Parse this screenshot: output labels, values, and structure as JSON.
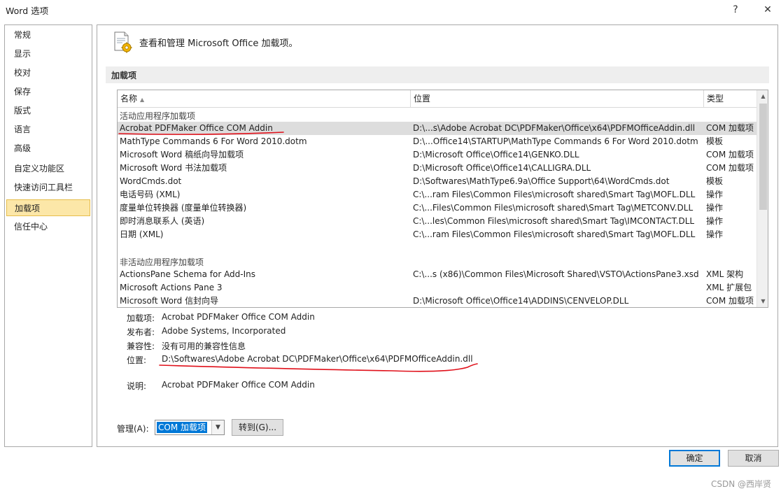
{
  "window": {
    "title": "Word 选项",
    "help_label": "?",
    "close_label": "✕"
  },
  "sidebar": {
    "items": [
      {
        "label": "常规"
      },
      {
        "label": "显示"
      },
      {
        "label": "校对"
      },
      {
        "label": "保存"
      },
      {
        "label": "版式"
      },
      {
        "label": "语言"
      },
      {
        "label": "高级"
      },
      {
        "label": "自定义功能区"
      },
      {
        "label": "快速访问工具栏"
      },
      {
        "label": "加载项",
        "active": true
      },
      {
        "label": "信任中心"
      }
    ]
  },
  "main": {
    "header_text": "查看和管理 Microsoft Office 加载项。",
    "section_title": "加载项",
    "columns": {
      "name": "名称",
      "location": "位置",
      "type": "类型"
    },
    "active_group_label": "活动应用程序加载项",
    "active_rows": [
      {
        "name": "Acrobat PDFMaker Office COM Addin",
        "location": "D:\\...s\\Adobe Acrobat DC\\PDFMaker\\Office\\x64\\PDFMOfficeAddin.dll",
        "type": "COM 加载项",
        "selected": true
      },
      {
        "name": "MathType Commands 6 For Word 2010.dotm",
        "location": "D:\\...Office14\\STARTUP\\MathType Commands 6 For Word 2010.dotm",
        "type": "模板"
      },
      {
        "name": "Microsoft Word 稿纸向导加载项",
        "location": "D:\\Microsoft Office\\Office14\\GENKO.DLL",
        "type": "COM 加载项"
      },
      {
        "name": "Microsoft Word 书法加载项",
        "location": "D:\\Microsoft Office\\Office14\\CALLIGRA.DLL",
        "type": "COM 加载项"
      },
      {
        "name": "WordCmds.dot",
        "location": "D:\\Softwares\\MathType6.9a\\Office Support\\64\\WordCmds.dot",
        "type": "模板"
      },
      {
        "name": "电话号码 (XML)",
        "location": "C:\\...ram Files\\Common Files\\microsoft shared\\Smart Tag\\MOFL.DLL",
        "type": "操作"
      },
      {
        "name": "度量单位转换器 (度量单位转换器)",
        "location": "C:\\...Files\\Common Files\\microsoft shared\\Smart Tag\\METCONV.DLL",
        "type": "操作"
      },
      {
        "name": "即时消息联系人 (英语)",
        "location": "C:\\...les\\Common Files\\microsoft shared\\Smart Tag\\IMCONTACT.DLL",
        "type": "操作"
      },
      {
        "name": "日期 (XML)",
        "location": "C:\\...ram Files\\Common Files\\microsoft shared\\Smart Tag\\MOFL.DLL",
        "type": "操作"
      }
    ],
    "inactive_group_label": "非活动应用程序加载项",
    "inactive_rows": [
      {
        "name": "ActionsPane Schema for Add-Ins",
        "location": "C:\\...s (x86)\\Common Files\\Microsoft Shared\\VSTO\\ActionsPane3.xsd",
        "type": "XML 架构"
      },
      {
        "name": "Microsoft Actions Pane 3",
        "location": "",
        "type": "XML 扩展包"
      },
      {
        "name": "Microsoft Word 信封向导",
        "location": "D:\\Microsoft Office\\Office14\\ADDINS\\CENVELOP.DLL",
        "type": "COM 加载项"
      }
    ],
    "details": {
      "addin_label": "加载项:",
      "addin_value": "Acrobat PDFMaker Office COM Addin",
      "publisher_label": "发布者:",
      "publisher_value": "Adobe Systems, Incorporated",
      "compat_label": "兼容性:",
      "compat_value": "没有可用的兼容性信息",
      "location_label": "位置:",
      "location_value": "D:\\Softwares\\Adobe Acrobat DC\\PDFMaker\\Office\\x64\\PDFMOfficeAddin.dll",
      "description_label": "说明:",
      "description_value": "Acrobat PDFMaker Office COM Addin"
    },
    "manage": {
      "label": "管理(A):",
      "selected_value": "COM 加载项",
      "go_label": "转到(G)..."
    }
  },
  "footer": {
    "ok_label": "确定",
    "cancel_label": "取消"
  },
  "watermark": "CSDN @西岸贤",
  "colors": {
    "selection_blue": "#0078d7",
    "active_nav": "#fce7a8",
    "annotation_red": "#e0101a"
  }
}
